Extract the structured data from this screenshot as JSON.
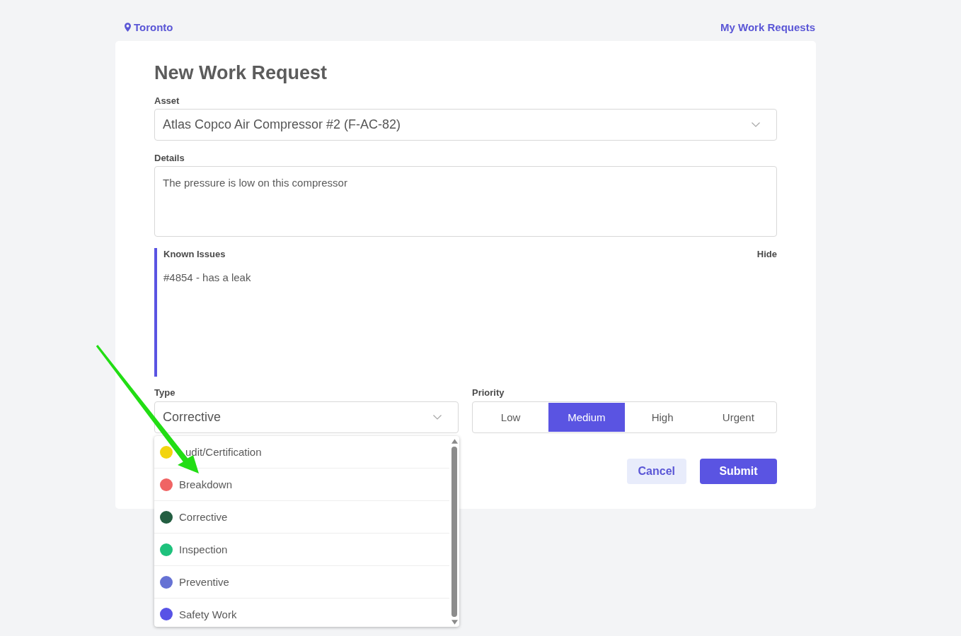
{
  "header": {
    "location": "Toronto",
    "link": "My Work Requests"
  },
  "form": {
    "title": "New Work Request",
    "asset": {
      "label": "Asset",
      "value": "Atlas Copco Air Compressor #2 (F-AC-82)"
    },
    "details": {
      "label": "Details",
      "value": "The pressure is low on this compressor"
    },
    "known_issues": {
      "title": "Known Issues",
      "toggle": "Hide",
      "items": [
        "#4854 - has a leak"
      ]
    },
    "type": {
      "label": "Type",
      "value": "Corrective",
      "options": [
        {
          "label": "udit/Certification",
          "color": "#f2d40f"
        },
        {
          "label": "Breakdown",
          "color": "#f06464"
        },
        {
          "label": "Corrective",
          "color": "#235e41"
        },
        {
          "label": "Inspection",
          "color": "#1ec17c"
        },
        {
          "label": "Preventive",
          "color": "#6672d4"
        },
        {
          "label": "Safety Work",
          "color": "#5853e6"
        }
      ]
    },
    "priority": {
      "label": "Priority",
      "options": [
        {
          "label": "Low",
          "selected": false
        },
        {
          "label": "Medium",
          "selected": true
        },
        {
          "label": "High",
          "selected": false
        },
        {
          "label": "Urgent",
          "selected": false
        }
      ]
    },
    "buttons": [
      {
        "label": "Cancel",
        "kind": "secondary"
      },
      {
        "label": "Submit",
        "kind": "primary"
      }
    ]
  }
}
